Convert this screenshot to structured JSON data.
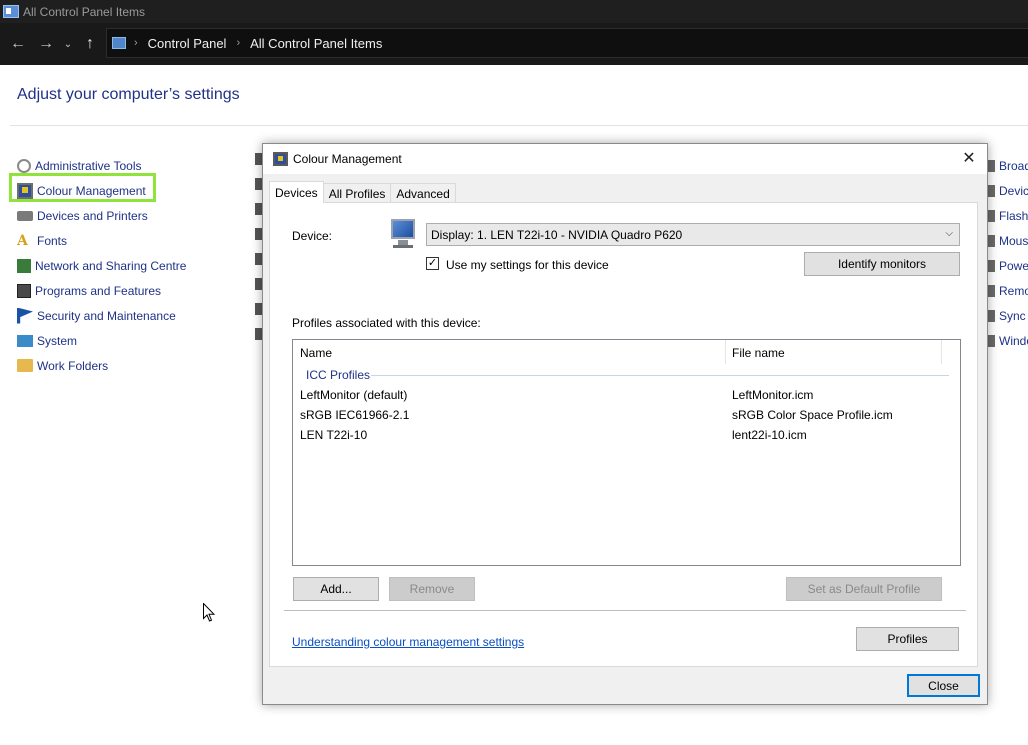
{
  "window": {
    "title": "All Control Panel Items"
  },
  "addressbar": {
    "back": "←",
    "forward": "→",
    "recent": "⌄",
    "up": "↑",
    "crumbs": [
      "Control Panel",
      "All Control Panel Items"
    ],
    "separator": "›"
  },
  "main": {
    "heading": "Adjust your computer’s settings",
    "items": [
      {
        "label": "Administrative Tools",
        "icon": "admin-tools-icon"
      },
      {
        "label": "Colour Management",
        "icon": "colour-management-icon"
      },
      {
        "label": "Devices and Printers",
        "icon": "devices-printers-icon"
      },
      {
        "label": "Fonts",
        "icon": "fonts-icon"
      },
      {
        "label": "Network and Sharing Centre",
        "icon": "network-icon"
      },
      {
        "label": "Programs and Features",
        "icon": "programs-icon"
      },
      {
        "label": "Security and Maintenance",
        "icon": "security-flag-icon"
      },
      {
        "label": "System",
        "icon": "system-icon"
      },
      {
        "label": "Work Folders",
        "icon": "work-folders-icon"
      }
    ],
    "right_items": [
      "Broad",
      "Device",
      "Flash",
      "Mous",
      "Power",
      "Remo",
      "Sync C",
      "Windo"
    ],
    "fonts_glyph": "A"
  },
  "dialog": {
    "title": "Colour Management",
    "close_glyph": "✕",
    "tabs": [
      "Devices",
      "All Profiles",
      "Advanced"
    ],
    "active_tab": "Devices",
    "device_label": "Device:",
    "device_value": "Display: 1. LEN T22i-10 - NVIDIA Quadro P620",
    "chevron": "⌵",
    "use_settings_label": "Use my settings for this device",
    "use_settings_checked": "✓",
    "identify_button": "Identify monitors",
    "profiles_label": "Profiles associated with this device:",
    "columns": [
      "Name",
      "File name"
    ],
    "group": "ICC Profiles",
    "profiles": [
      {
        "name": "LeftMonitor (default)",
        "file": "LeftMonitor.icm"
      },
      {
        "name": "sRGB IEC61966-2.1",
        "file": "sRGB Color Space Profile.icm"
      },
      {
        "name": "LEN T22i-10",
        "file": "lent22i-10.icm"
      }
    ],
    "add_button": "Add...",
    "remove_button": "Remove",
    "set_default_button": "Set as Default Profile",
    "link": "Understanding colour management settings",
    "profiles_button": "Profiles",
    "close_button": "Close"
  },
  "colors": {
    "highlight": "#8fe33a",
    "link": "#1e3287",
    "accent": "#0078d7"
  }
}
